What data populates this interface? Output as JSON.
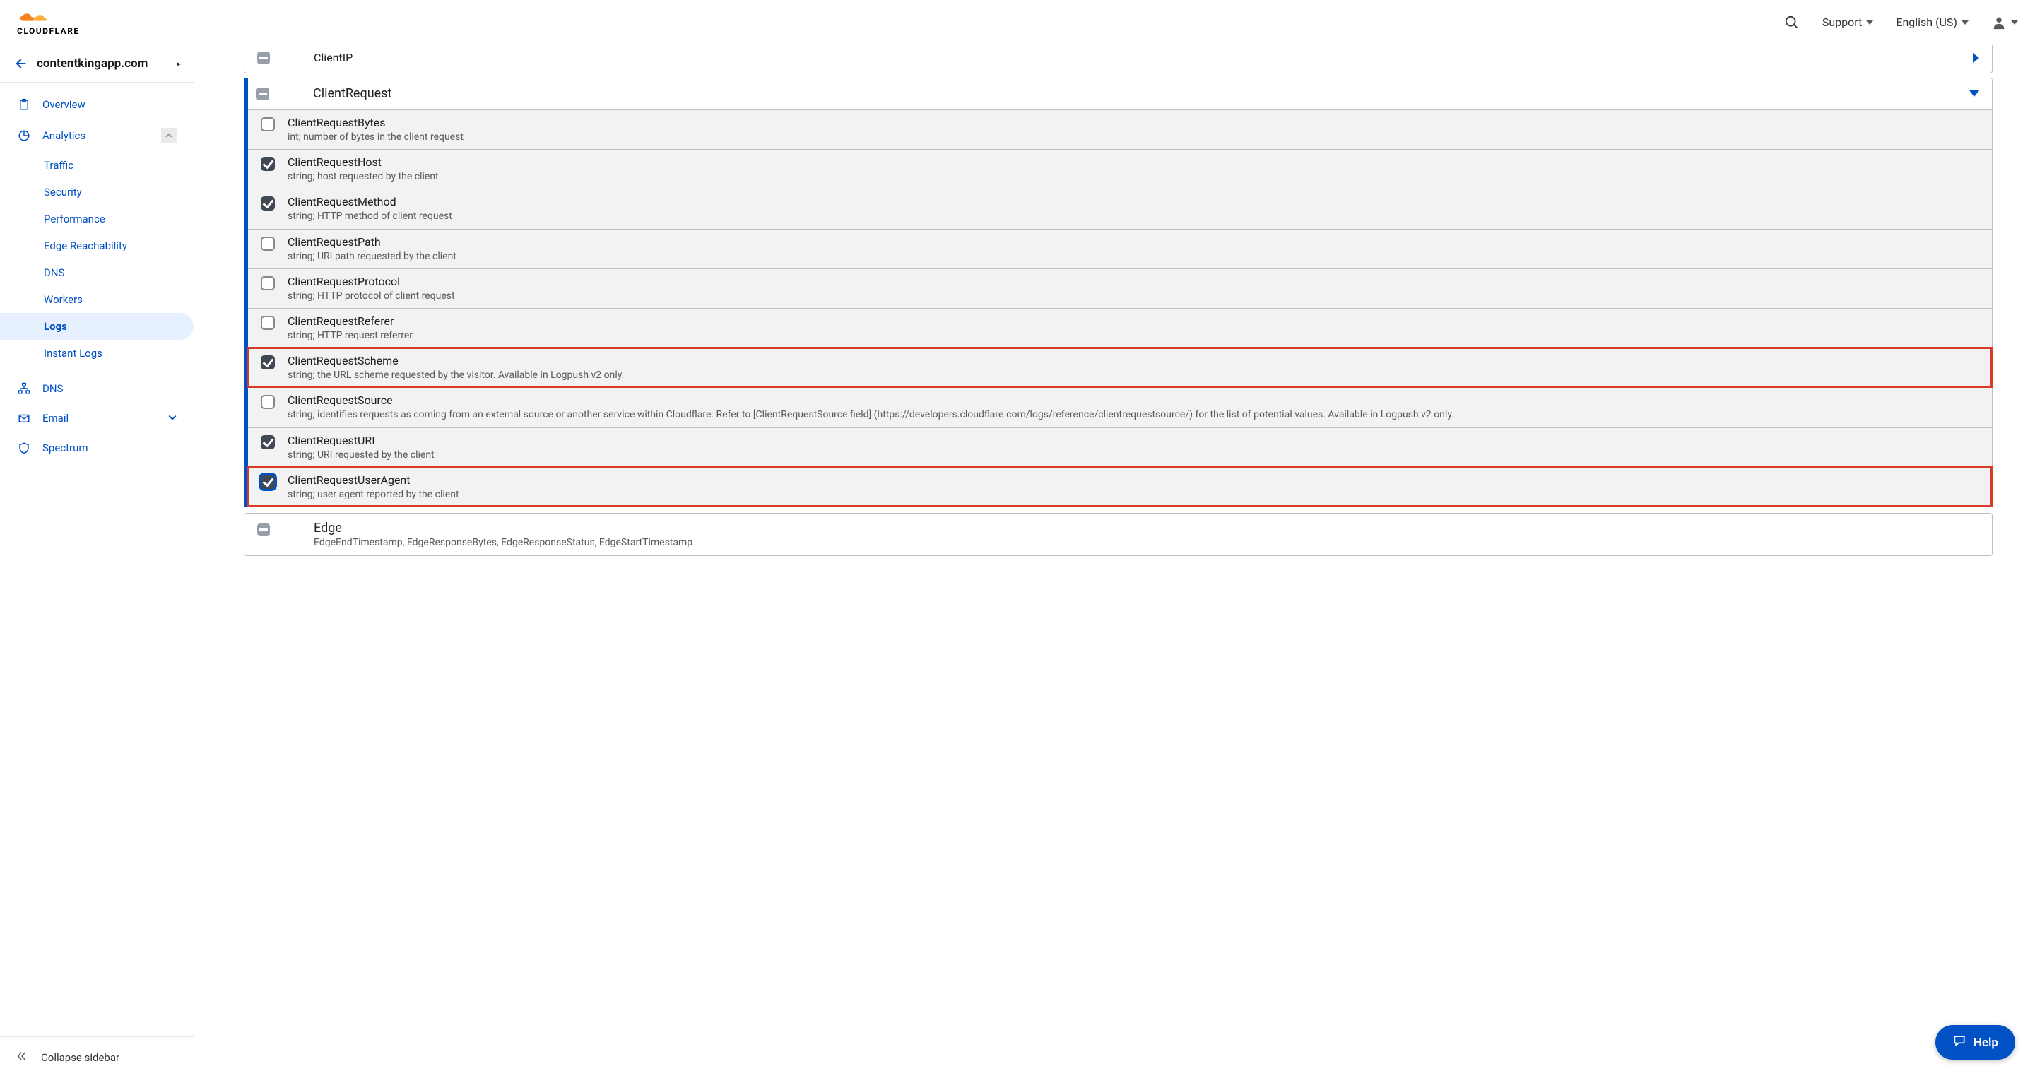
{
  "header": {
    "brand": "CLOUDFLARE",
    "support": "Support",
    "language": "English (US)"
  },
  "sidebar": {
    "domain": "contentkingapp.com",
    "items": {
      "overview": "Overview",
      "analytics": "Analytics",
      "dns": "DNS",
      "email": "Email",
      "spectrum": "Spectrum"
    },
    "analytics_sub": {
      "traffic": "Traffic",
      "security": "Security",
      "performance": "Performance",
      "edge": "Edge Reachability",
      "dns": "DNS",
      "workers": "Workers",
      "logs": "Logs",
      "instant": "Instant Logs"
    },
    "collapse": "Collapse sidebar"
  },
  "main": {
    "clientip_label": "ClientIP",
    "group_title": "ClientRequest",
    "fields": [
      {
        "name": "ClientRequestBytes",
        "desc": "int; number of bytes in the client request",
        "checked": false,
        "hl": false,
        "focused": false
      },
      {
        "name": "ClientRequestHost",
        "desc": "string; host requested by the client",
        "checked": true,
        "hl": false,
        "focused": false
      },
      {
        "name": "ClientRequestMethod",
        "desc": "string; HTTP method of client request",
        "checked": true,
        "hl": false,
        "focused": false
      },
      {
        "name": "ClientRequestPath",
        "desc": "string; URI path requested by the client",
        "checked": false,
        "hl": false,
        "focused": false
      },
      {
        "name": "ClientRequestProtocol",
        "desc": "string; HTTP protocol of client request",
        "checked": false,
        "hl": false,
        "focused": false
      },
      {
        "name": "ClientRequestReferer",
        "desc": "string; HTTP request referrer",
        "checked": false,
        "hl": false,
        "focused": false
      },
      {
        "name": "ClientRequestScheme",
        "desc": "string; the URL scheme requested by the visitor. Available in Logpush v2 only.",
        "checked": true,
        "hl": true,
        "focused": false
      },
      {
        "name": "ClientRequestSource",
        "desc": "string; identifies requests as coming from an external source or another service within Cloudflare. Refer to [ClientRequestSource field] (https://developers.cloudflare.com/logs/reference/clientrequestsource/) for the list of potential values. Available in Logpush v2 only.",
        "checked": false,
        "hl": false,
        "focused": false
      },
      {
        "name": "ClientRequestURI",
        "desc": "string; URI requested by the client",
        "checked": true,
        "hl": false,
        "focused": false
      },
      {
        "name": "ClientRequestUserAgent",
        "desc": "string; user agent reported by the client",
        "checked": true,
        "hl": true,
        "focused": true
      }
    ],
    "edge": {
      "title": "Edge",
      "sub": "EdgeEndTimestamp, EdgeResponseBytes, EdgeResponseStatus, EdgeStartTimestamp"
    }
  },
  "help": "Help"
}
